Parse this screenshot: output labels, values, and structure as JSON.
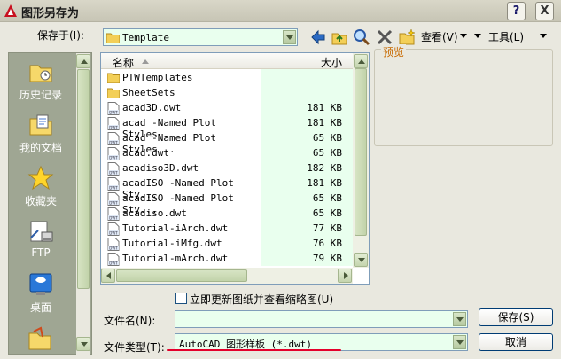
{
  "title": "图形另存为",
  "title_buttons": {
    "help": "?",
    "close": "X"
  },
  "save_in": {
    "label": "保存于(I):",
    "value": "Template"
  },
  "toolbar": {
    "views_label": "查看(V)",
    "tools_label": "工具(L)"
  },
  "places": [
    {
      "label": "历史记录",
      "icon": "history-folder-icon"
    },
    {
      "label": "我的文档",
      "icon": "my-documents-icon"
    },
    {
      "label": "收藏夹",
      "icon": "favorites-star-icon"
    },
    {
      "label": "FTP",
      "icon": "ftp-icon"
    },
    {
      "label": "桌面",
      "icon": "desktop-icon"
    }
  ],
  "list": {
    "col_name": "名称",
    "col_size": "大小",
    "rows": [
      {
        "name": "PTWTemplates",
        "size": "",
        "type": "folder"
      },
      {
        "name": "SheetSets",
        "size": "",
        "type": "folder"
      },
      {
        "name": "acad3D.dwt",
        "size": "181 KB",
        "type": "dwt"
      },
      {
        "name": "acad -Named Plot Styles...",
        "size": "181 KB",
        "type": "dwt"
      },
      {
        "name": "acad -Named Plot Styles...",
        "size": "65 KB",
        "type": "dwt"
      },
      {
        "name": "acad.dwt",
        "size": "65 KB",
        "type": "dwt"
      },
      {
        "name": "acadiso3D.dwt",
        "size": "182 KB",
        "type": "dwt"
      },
      {
        "name": "acadISO -Named Plot Sty...",
        "size": "181 KB",
        "type": "dwt"
      },
      {
        "name": "acadISO -Named Plot Sty...",
        "size": "65 KB",
        "type": "dwt"
      },
      {
        "name": "acadiso.dwt",
        "size": "65 KB",
        "type": "dwt"
      },
      {
        "name": "Tutorial-iArch.dwt",
        "size": "77 KB",
        "type": "dwt"
      },
      {
        "name": "Tutorial-iMfg.dwt",
        "size": "76 KB",
        "type": "dwt"
      },
      {
        "name": "Tutorial-mArch.dwt",
        "size": "79 KB",
        "type": "dwt"
      }
    ]
  },
  "preview": {
    "label": "预览"
  },
  "thumbnail_checkbox": {
    "label": "立即更新图纸并查看缩略图(U)",
    "checked": false
  },
  "filename": {
    "label": "文件名(N):",
    "value": ""
  },
  "filetype": {
    "label": "文件类型(T):",
    "value": "AutoCAD 图形样板 (*.dwt)"
  },
  "buttons": {
    "save": "保存(S)",
    "cancel": "取消"
  },
  "colors": {
    "accent_underline": "#e4002b",
    "list_bg": "#e9ffee",
    "dialog_bg": "#e9e8df",
    "places_bg": "#9fa693"
  }
}
